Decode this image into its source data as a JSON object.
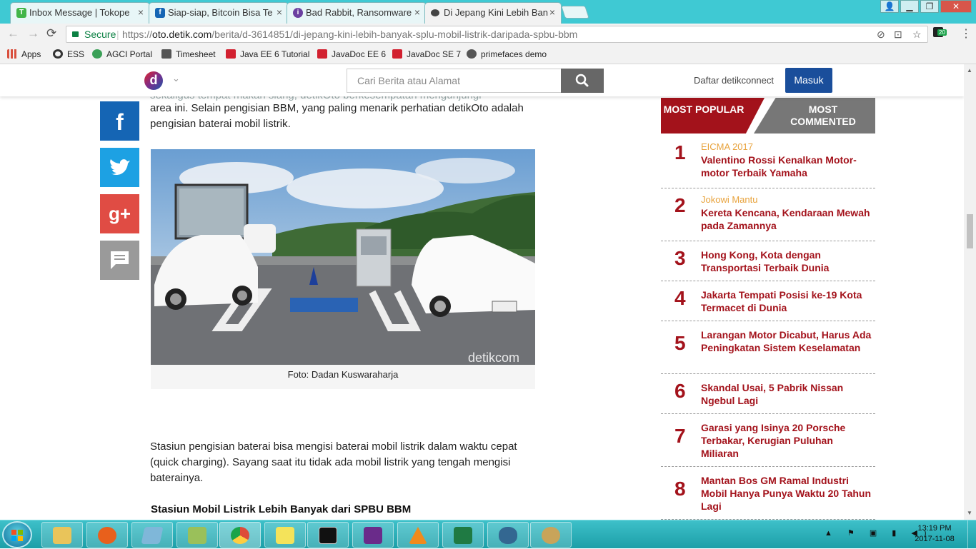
{
  "browser": {
    "tabs": [
      {
        "title": "Inbox Message | Tokope",
        "favicon": "tokopedia-icon",
        "color": "#42b549"
      },
      {
        "title": "Siap-siap, Bitcoin Bisa Te",
        "favicon": "facebook-icon",
        "color": "#1565b4"
      },
      {
        "title": "Bad Rabbit, Ransomware",
        "favicon": "yahoo-icon",
        "color": "#6b3fa0"
      },
      {
        "title": "Di Jepang Kini Lebih Ban",
        "favicon": "detik-icon",
        "color": "#444444"
      }
    ],
    "close_glyph": "×",
    "window_controls": {
      "user": "👤",
      "minimize": "▁",
      "maximize": "❐",
      "close": "✕"
    },
    "nav": {
      "back": "←",
      "forward": "→",
      "reload": "⟳"
    },
    "secure_label": "Secure",
    "url_prefix": "https://",
    "url_domain": "oto.detik.com",
    "url_path": "/berita/d-3614851/di-jepang-kini-lebih-banyak-splu-mobil-listrik-daripada-spbu-bbm",
    "extension_badge": "20",
    "bookmarks": [
      {
        "label": "Apps",
        "icon": "apps-grid-icon",
        "color": "#d94f3d"
      },
      {
        "label": "ESS",
        "icon": "ess-icon",
        "color": "#333333"
      },
      {
        "label": "AGCI Portal",
        "icon": "agci-icon",
        "color": "#3aa057"
      },
      {
        "label": "Timesheet",
        "icon": "timesheet-icon",
        "color": "#555555"
      },
      {
        "label": "Java EE 6 Tutorial",
        "icon": "oracle-icon",
        "color": "#d2202f"
      },
      {
        "label": "JavaDoc EE 6",
        "icon": "oracle-icon",
        "color": "#d2202f"
      },
      {
        "label": "JavaDoc SE 7",
        "icon": "oracle-icon",
        "color": "#d2202f"
      },
      {
        "label": "primefaces demo",
        "icon": "primefaces-icon",
        "color": "#555555"
      }
    ]
  },
  "site": {
    "logo": "d",
    "search_placeholder": "Cari Berita atau Alamat",
    "register_label": "Daftar detikconnect",
    "login_label": "Masuk",
    "brand_color": "#1a4e9b"
  },
  "article": {
    "faded_line": "sekaligus tempat makan siang, detikOto berkesempatan mengunjungi",
    "para1": "area ini. Selain pengisian BBM, yang paling menarik perhatian detikOto adalah pengisian baterai mobil listrik.",
    "photo_watermark": "detikcom",
    "photo_caption": "Foto: Dadan Kuswaraharja",
    "para2": "Stasiun pengisian baterai bisa mengisi baterai mobil listrik dalam waktu cepat (quick charging). Sayang saat itu tidak ada mobil listrik yang tengah mengisi baterainya.",
    "subheading": "Stasiun Mobil Listrik Lebih Banyak dari SPBU BBM"
  },
  "sidebar": {
    "tab_popular": "MOST POPULAR",
    "tab_commented": "MOST COMMENTED",
    "accent": "#a3121b",
    "items": [
      {
        "num": "1",
        "category": "EICMA 2017",
        "title": "Valentino Rossi Kenalkan Motor-motor Terbaik Yamaha"
      },
      {
        "num": "2",
        "category": "Jokowi Mantu",
        "title": "Kereta Kencana, Kendaraan Mewah pada Zamannya"
      },
      {
        "num": "3",
        "category": "",
        "title": "Hong Kong, Kota dengan Transportasi Terbaik Dunia"
      },
      {
        "num": "4",
        "category": "",
        "title": "Jakarta Tempati Posisi ke-19 Kota Termacet di Dunia"
      },
      {
        "num": "5",
        "category": "",
        "title": "Larangan Motor Dicabut, Harus Ada Peningkatan Sistem Keselamatan"
      },
      {
        "num": "6",
        "category": "",
        "title": "Skandal Usai, 5 Pabrik Nissan Ngebul Lagi"
      },
      {
        "num": "7",
        "category": "",
        "title": "Garasi yang Isinya 20 Porsche Terbakar, Kerugian Puluhan Miliaran"
      },
      {
        "num": "8",
        "category": "",
        "title": "Mantan Bos GM Ramal Industri Mobil Hanya Punya Waktu 20 Tahun Lagi"
      }
    ]
  },
  "taskbar": {
    "apps": [
      {
        "name": "file-explorer",
        "color": "#e9c45a"
      },
      {
        "name": "firefox",
        "color": "#e8601c"
      },
      {
        "name": "notes",
        "color": "#7fb7d9"
      },
      {
        "name": "notepad-plus",
        "color": "#9ac05a"
      },
      {
        "name": "chrome",
        "color": "#dd4b39"
      },
      {
        "name": "sticky-notes",
        "color": "#f4e35a"
      },
      {
        "name": "command-prompt",
        "color": "#111111"
      },
      {
        "name": "java-ee-ide",
        "color": "#6a2b8a"
      },
      {
        "name": "vlc",
        "color": "#f08a1c"
      },
      {
        "name": "excel",
        "color": "#1f7a43"
      },
      {
        "name": "postgres",
        "color": "#336791"
      },
      {
        "name": "paint",
        "color": "#c8a45a"
      }
    ],
    "tray": "▲ ⚑ ▣ ▮ ◀)",
    "time": "13:19 PM",
    "date": "2017-11-08"
  }
}
